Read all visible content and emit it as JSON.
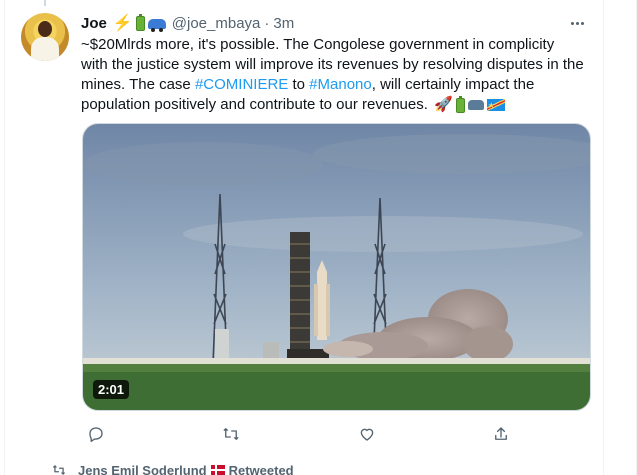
{
  "tweet": {
    "author_name": "Joe",
    "author_emojis": [
      "lightning-emoji",
      "battery-emoji",
      "car-emoji"
    ],
    "handle": "@joe_mbaya",
    "separator": "·",
    "time": "3m",
    "text": {
      "line1": "~$20Mlrds more, it's possible. The Congolese government in complicity",
      "line2": "with the justice system will improve its revenues by resolving disputes in the",
      "line3_prefix": "mines. The case ",
      "hashtag1": "#COMINIERE",
      "line3_mid": " to ",
      "hashtag2": "#Manono",
      "line3_suffix": ", will certainly impact the",
      "line4": "population positively and contribute to our revenues.",
      "tail_emojis": [
        "rocket-emoji",
        "battery-emoji",
        "car-emoji",
        "drc-flag-emoji"
      ]
    },
    "video": {
      "duration": "2:01"
    },
    "actions": [
      "reply",
      "retweet",
      "like",
      "share"
    ]
  },
  "next_tweet": {
    "retweeted_by": "Jens Emil Soderlund",
    "retweeted_label": "Retweeted"
  },
  "colors": {
    "accent": "#1d9bf0",
    "secondary_text": "#536471",
    "primary_text": "#0f1419"
  }
}
